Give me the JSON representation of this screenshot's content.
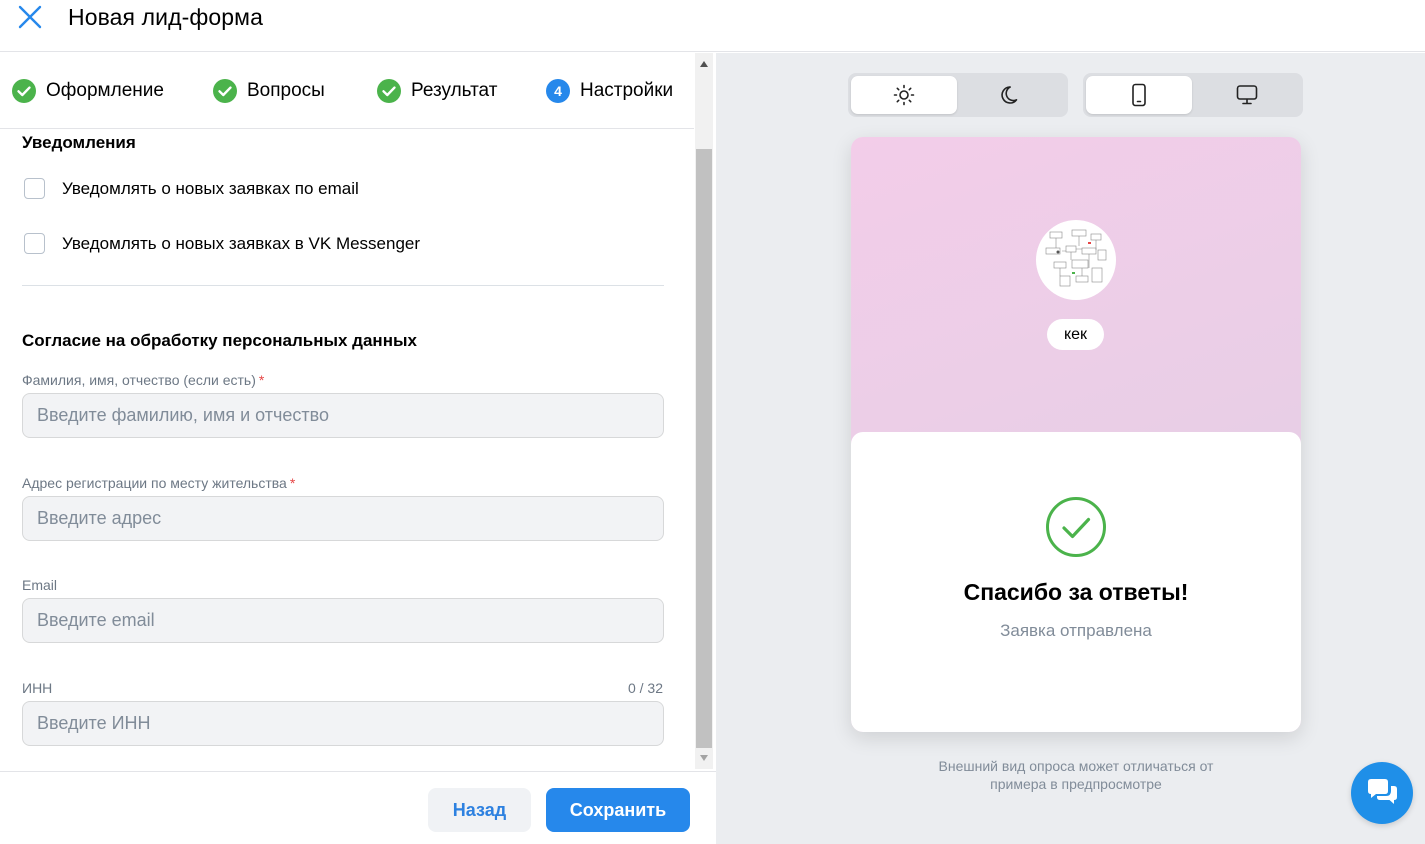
{
  "header": {
    "title": "Новая лид-форма"
  },
  "stepper": {
    "steps": [
      {
        "label": "Оформление",
        "status": "done"
      },
      {
        "label": "Вопросы",
        "status": "done"
      },
      {
        "label": "Результат",
        "status": "done"
      },
      {
        "label": "Настройки",
        "status": "current",
        "number": "4"
      }
    ]
  },
  "notifications": {
    "title": "Уведомления",
    "options": [
      {
        "label": "Уведомлять о новых заявках по email",
        "checked": false
      },
      {
        "label": "Уведомлять о новых заявках в VK Messenger",
        "checked": false
      }
    ]
  },
  "consent": {
    "title": "Согласие на обработку персональных данных",
    "fields": [
      {
        "label": "Фамилия, имя, отчество (если есть)",
        "required": true,
        "required_mark": "*",
        "placeholder": "Введите фамилию, имя и отчество",
        "value": ""
      },
      {
        "label": "Адрес регистрации по месту жительства",
        "required": true,
        "required_mark": "*",
        "placeholder": "Введите адрес",
        "value": ""
      },
      {
        "label": "Email",
        "required": false,
        "placeholder": "Введите email",
        "value": ""
      },
      {
        "label": "ИНН",
        "required": false,
        "placeholder": "Введите ИНН",
        "value": "",
        "counter": "0 / 32"
      }
    ]
  },
  "footer": {
    "back_label": "Назад",
    "save_label": "Сохранить"
  },
  "preview": {
    "theme_toggle": {
      "options": [
        "sun-icon",
        "moon-icon"
      ],
      "selected": "sun-icon"
    },
    "device_toggle": {
      "options": [
        "phone-icon",
        "desktop-icon"
      ],
      "selected": "phone-icon"
    },
    "community_name": "кек",
    "result_title": "Спасибо за ответы!",
    "result_subtitle": "Заявка отправлена",
    "disclaimer": "Внешний вид опроса может отличаться от примера в предпросмотре"
  },
  "colors": {
    "accent": "#2688eb",
    "success": "#4bb34b",
    "required": "#e64646",
    "preview_background": "#f0cde8"
  }
}
